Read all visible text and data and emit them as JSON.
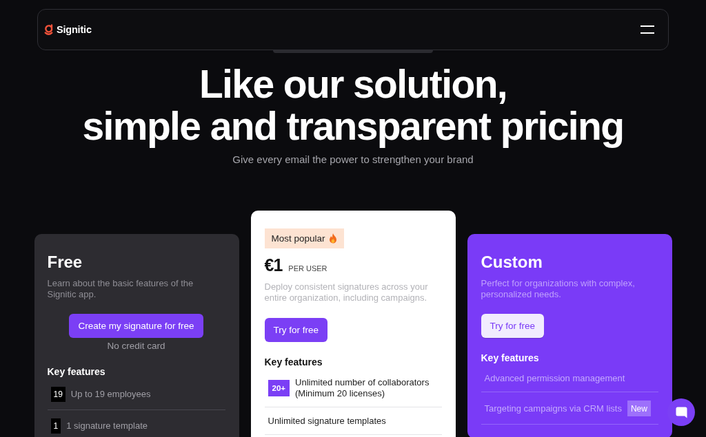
{
  "header": {
    "brand": "Signitic"
  },
  "hero": {
    "title_lines": [
      "Like our solution,",
      "simple and transparent pricing"
    ],
    "subtitle": "Give every email the power to strengthen your brand"
  },
  "plans": [
    {
      "kind": "dark",
      "name": "Free",
      "description": "Learn about the basic features of the Signitic app.",
      "button": "Create my signature for free",
      "button_note": "No credit card",
      "features_title": "Key features",
      "features": [
        {
          "badge": "19",
          "text": "Up to 19 employees"
        },
        {
          "badge": "1",
          "text": "1 signature template"
        }
      ]
    },
    {
      "kind": "light",
      "tag": "Most popular",
      "price": "€1",
      "price_unit": "PER USER",
      "description": "Deploy consistent signatures across your entire organization, including campaigns.",
      "button": "Try for free",
      "features_title": "Key features",
      "features": [
        {
          "badge": "20+",
          "text": "Unlimited number of collaborators (Minimum 20 licenses)"
        },
        {
          "text": "Unlimited signature templates"
        }
      ]
    },
    {
      "kind": "accent",
      "name": "Custom",
      "description": "Perfect for organizations with complex, personalized needs.",
      "button": "Try for free",
      "features_title": "Key features",
      "features": [
        {
          "text": "Advanced permission management"
        },
        {
          "text": "Targeting campaigns via CRM lists",
          "tag": "New"
        }
      ]
    }
  ]
}
